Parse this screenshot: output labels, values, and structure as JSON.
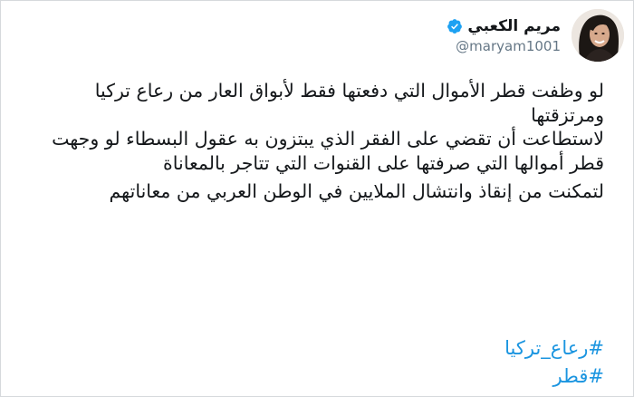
{
  "author": {
    "display_name": "مريم الكعبي",
    "handle": "@maryam1001",
    "verified_icon": "verified-badge-icon",
    "verified_color": "#1da1f2"
  },
  "tweet": {
    "paragraphs": [
      "لو وظفت قطر الأموال التي دفعتها فقط لأبواق العار من رعاع تركيا ومرتزقتها",
      "لاستطاعت أن تقضي على الفقر الذي يبتزون به عقول البسطاء لو وجهت قطر أموالها التي صرفتها على القنوات التي تتاجر بالمعاناة",
      "لتمكنت من إنقاذ وانتشال  الملايين في الوطن العربي من معاناتهم"
    ],
    "hashtags": [
      "#رعاع_تركيا",
      "#قطر"
    ]
  },
  "colors": {
    "text": "#14171a",
    "secondary": "#657786",
    "link": "#1b95e0"
  }
}
